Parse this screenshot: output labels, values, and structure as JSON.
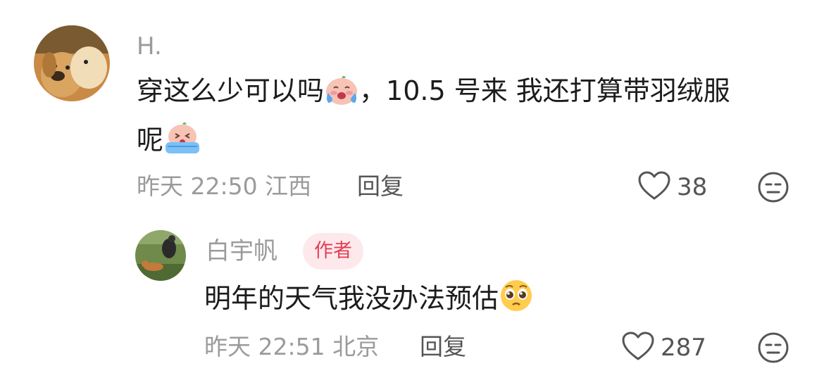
{
  "comment": {
    "username": "H.",
    "text_line1": "穿这么少可以吗",
    "text_line1b": "，10.5 号来 我还打算带羽绒服",
    "text_line2": "呢",
    "time": "昨天 22:50",
    "location": "江西",
    "reply_label": "回复",
    "likes": "38",
    "emojis": [
      "crying-baby-emoji",
      "sobbing-baby-emoji"
    ]
  },
  "reply": {
    "username": "白宇帆",
    "badge": "作者",
    "text": "明年的天气我没办法预估",
    "time": "昨天 22:51",
    "location": "北京",
    "reply_label": "回复",
    "likes": "287",
    "emojis": [
      "pleading-face-emoji"
    ]
  },
  "colors": {
    "meta_gray": "#9b9b9b",
    "text": "#1c1c1c",
    "badge_bg": "#fde9ec",
    "badge_text": "#e53e54"
  }
}
